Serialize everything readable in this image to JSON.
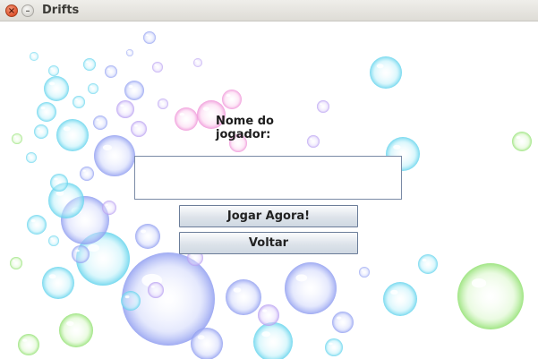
{
  "window": {
    "title": "Drifts",
    "close_icon": "close-icon",
    "minimize_icon": "minimize-icon"
  },
  "form": {
    "player_label": "Nome do jogador:",
    "player_name_value": "",
    "play_button_label": "Jogar Agora!",
    "back_button_label": "Voltar"
  },
  "colors": {
    "button_border": "#6b7d99",
    "field_border": "#7a8aa6",
    "titlebar": "#dedcd6"
  }
}
